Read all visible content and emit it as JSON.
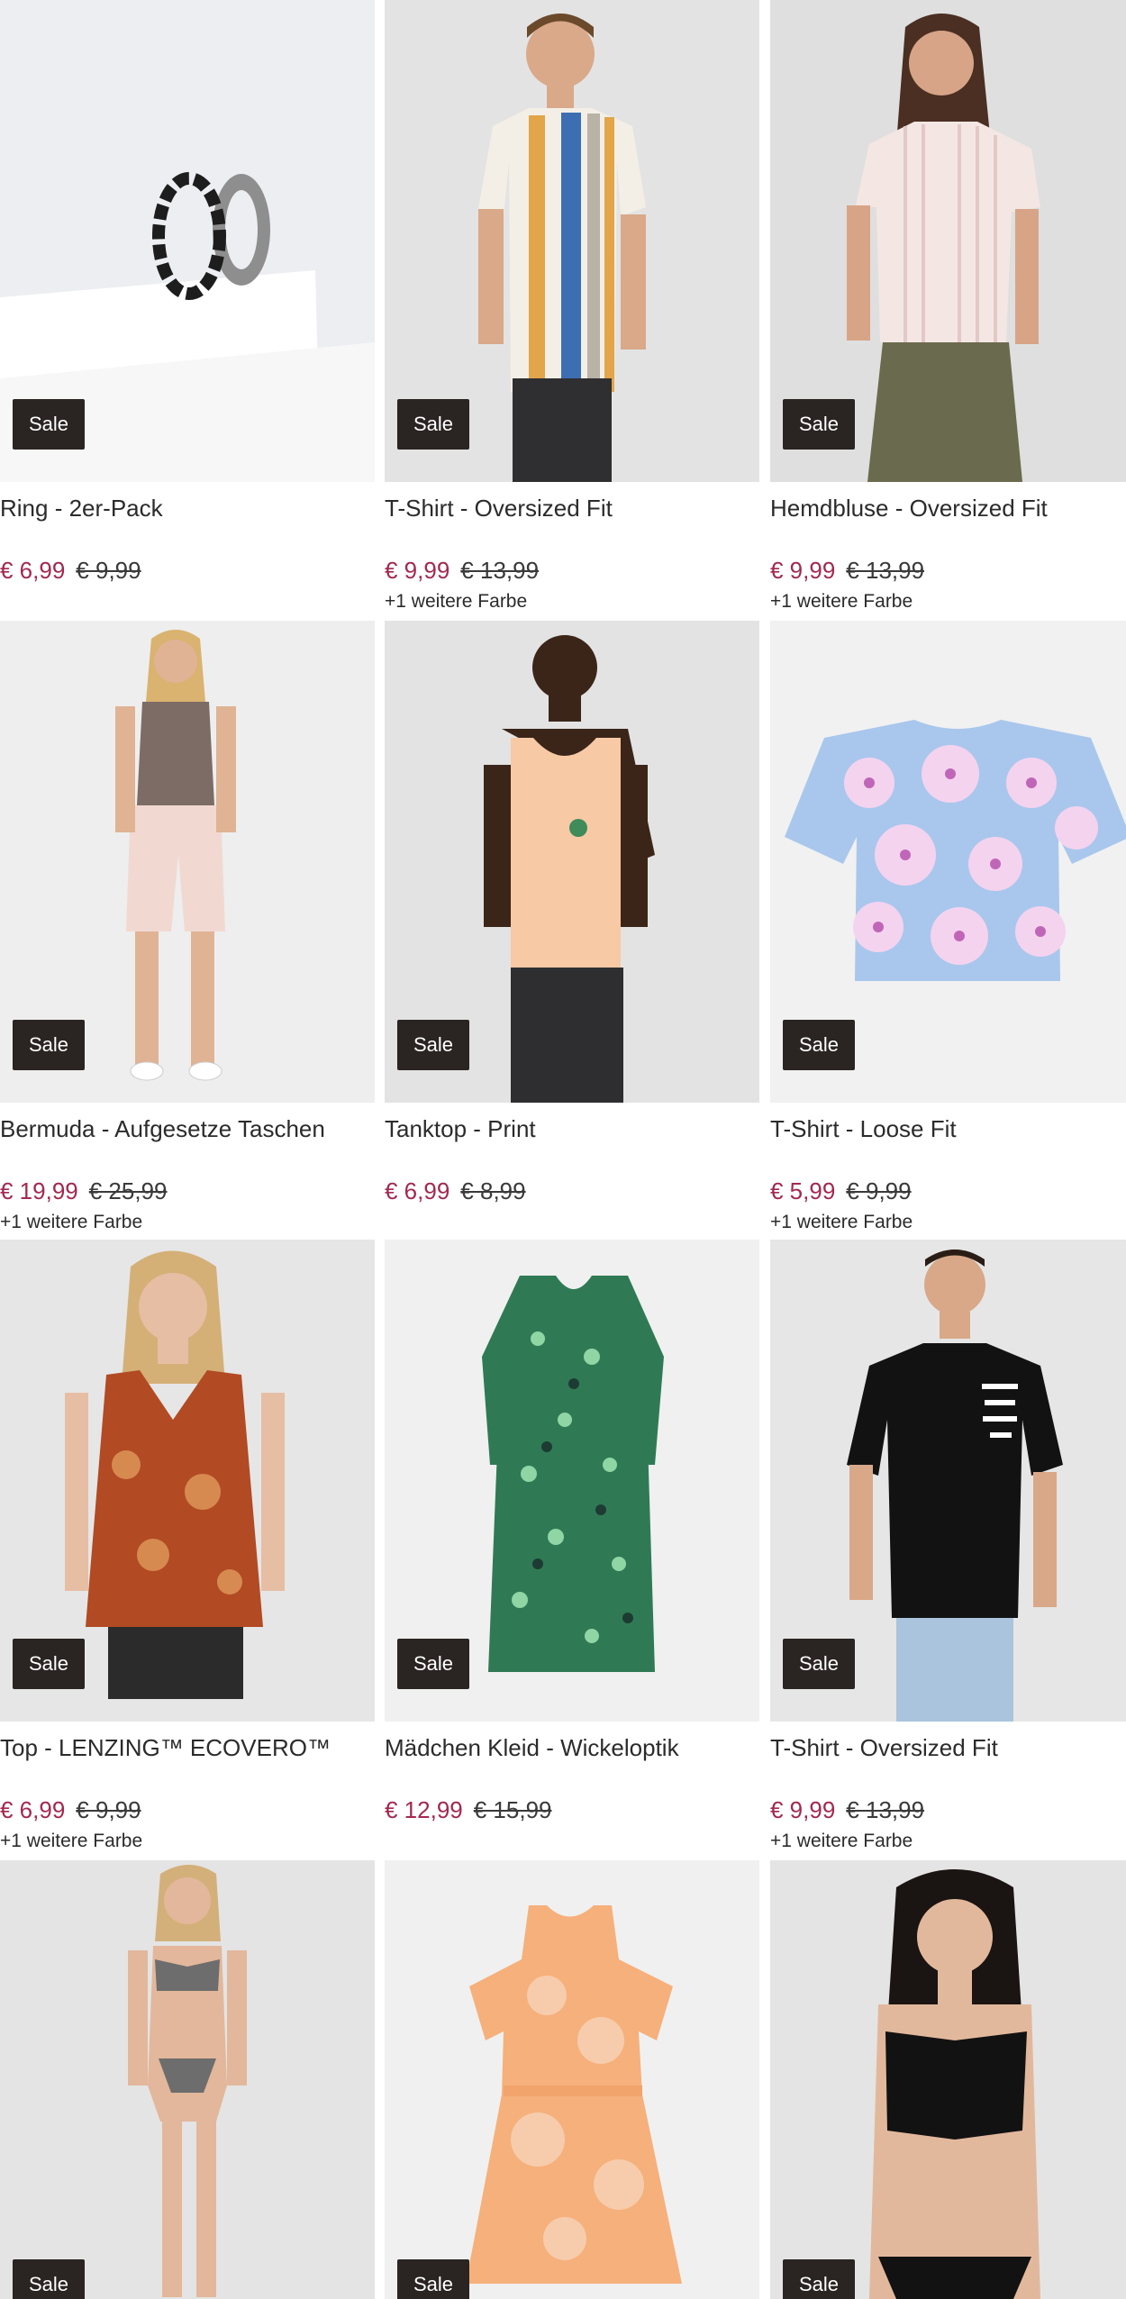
{
  "products": [
    {
      "title": "Ring - 2er-Pack",
      "price": "€ 6,99",
      "old_price": "€ 9,99",
      "colors": "",
      "badge": "Sale",
      "bg": "#e9ebee",
      "art": "ring"
    },
    {
      "title": "T-Shirt - Oversized Fit",
      "price": "€ 9,99",
      "old_price": "€ 13,99",
      "colors": "+1 weitere Farbe",
      "badge": "Sale",
      "bg": "#e4e4e4",
      "art": "tee-stripes"
    },
    {
      "title": "Hemdbluse - Oversized Fit",
      "price": "€ 9,99",
      "old_price": "€ 13,99",
      "colors": "+1 weitere Farbe",
      "badge": "Sale",
      "bg": "#e0e0e0",
      "art": "blouse"
    },
    {
      "title": "Bermuda - Aufgesetze Taschen",
      "price": "€ 19,99",
      "old_price": "€ 25,99",
      "colors": "+1 weitere Farbe",
      "badge": "Sale",
      "bg": "#eeeeee",
      "art": "bermuda"
    },
    {
      "title": "Tanktop - Print",
      "price": "€ 6,99",
      "old_price": "€ 8,99",
      "colors": "",
      "badge": "Sale",
      "bg": "#e4e4e4",
      "art": "tanktop"
    },
    {
      "title": "T-Shirt - Loose Fit",
      "price": "€ 5,99",
      "old_price": "€ 9,99",
      "colors": "+1 weitere Farbe",
      "badge": "Sale",
      "bg": "#f1f1f1",
      "art": "floral-tee"
    },
    {
      "title": "Top - LENZING™ ECOVERO™",
      "price": "€ 6,99",
      "old_price": "€ 9,99",
      "colors": "+1 weitere Farbe",
      "badge": "Sale",
      "bg": "#e6e6e6",
      "art": "top"
    },
    {
      "title": "Mädchen Kleid - Wickeloptik",
      "price": "€ 12,99",
      "old_price": "€ 15,99",
      "colors": "",
      "badge": "Sale",
      "bg": "#f0f0f0",
      "art": "dress-green"
    },
    {
      "title": "T-Shirt - Oversized Fit",
      "price": "€ 9,99",
      "old_price": "€ 13,99",
      "colors": "+1 weitere Farbe",
      "badge": "Sale",
      "bg": "#e6e6e6",
      "art": "black-tee"
    },
    {
      "title": "",
      "price": "",
      "old_price": "",
      "colors": "",
      "badge": "Sale",
      "bg": "#e4e4e4",
      "art": "bikini-check"
    },
    {
      "title": "",
      "price": "",
      "old_price": "",
      "colors": "",
      "badge": "Sale",
      "bg": "#f0f0f0",
      "art": "dress-orange"
    },
    {
      "title": "",
      "price": "",
      "old_price": "",
      "colors": "",
      "badge": "Sale",
      "bg": "#e4e4e4",
      "art": "bikini-black"
    }
  ]
}
